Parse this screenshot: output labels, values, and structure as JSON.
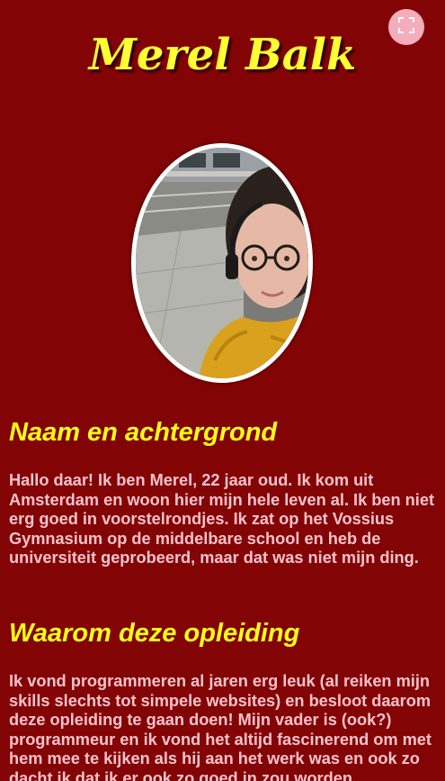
{
  "header": {
    "title": "Merel Balk"
  },
  "fullscreen_button": {
    "icon": "fullscreen-icon"
  },
  "profile": {
    "photo_alt": "Portret van Merel"
  },
  "sections": [
    {
      "heading": "Naam en achtergrond",
      "text": "Hallo daar! Ik ben Merel, 22 jaar oud. Ik kom uit Amsterdam en woon hier mijn hele leven al. Ik ben niet erg goed in voorstelrondjes. Ik zat op het Vossius Gymnasium op de middelbare school en heb de universiteit geprobeerd, maar dat was niet mijn ding."
    },
    {
      "heading": "Waarom deze opleiding",
      "text": "Ik vond programmeren al jaren erg leuk (al reiken mijn skills slechts tot simpele websites) en besloot daarom deze opleiding te gaan doen! Mijn vader is (ook?) programmeur en ik vond het altijd fascinerend om met hem mee te kijken als hij aan het werk was en ook zo dacht ik dat ik er ook zo goed in zou worden."
    }
  ],
  "colors": {
    "background": "#830405",
    "title": "#ffff33",
    "heading": "#ffff1a",
    "body_text": "#f8c3cc",
    "fullscreen_button": "#f4aebb"
  }
}
